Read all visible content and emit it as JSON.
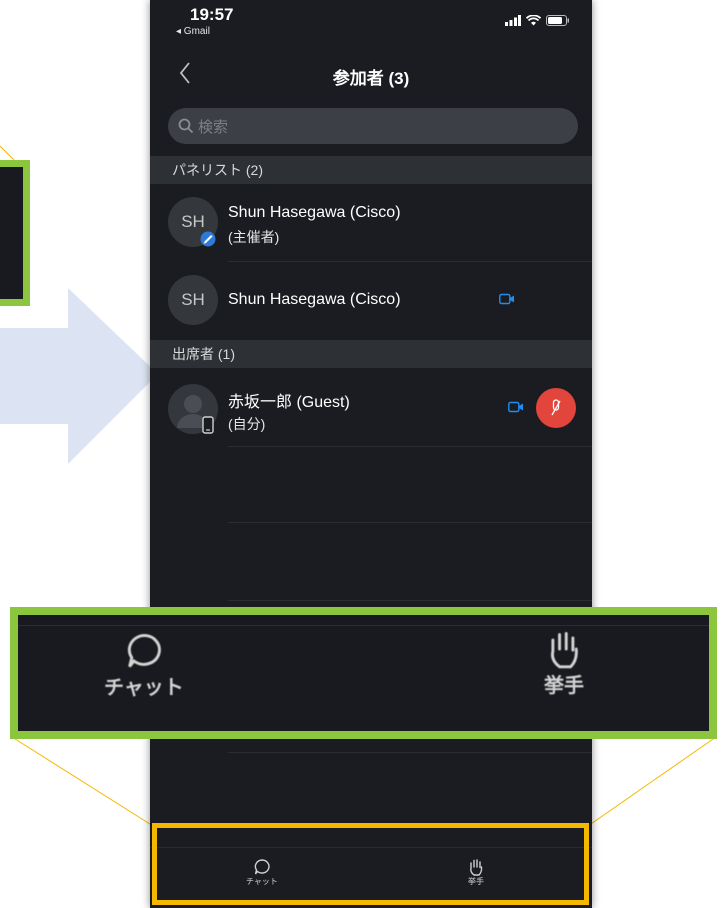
{
  "status": {
    "time": "19:57",
    "back_app": "◂ Gmail"
  },
  "nav": {
    "title": "参加者 (3)"
  },
  "search": {
    "placeholder": "検索"
  },
  "sections": {
    "panelists": "パネリスト (2)",
    "attendees": "出席者 (1)"
  },
  "participants": [
    {
      "initials": "SH",
      "name": "Shun Hasegawa (Cisco)",
      "role": "(主催者)"
    },
    {
      "initials": "SH",
      "name": "Shun Hasegawa (Cisco)",
      "role": ""
    },
    {
      "initials": "",
      "name": "赤坂一郎 (Guest)",
      "role": "(自分)"
    }
  ],
  "bottom_bar": {
    "chat": "チャット",
    "raise_hand": "挙手"
  },
  "zoom": {
    "chat": "チャット",
    "raise_hand": "挙手"
  },
  "colors": {
    "phone_bg": "#1a1c21",
    "section_bg": "#2d3035",
    "search_bg": "#3c3f45",
    "mute_red": "#e2453c",
    "video_blue": "#1e8ef0",
    "highlight_green": "#8cc63f",
    "highlight_yellow": "#f5b800",
    "arrow": "#dce3f2"
  },
  "icons": [
    "back-chevron-icon",
    "search-icon",
    "video-icon",
    "muted-mic-icon",
    "chat-icon",
    "raise-hand-icon",
    "signal-icon",
    "wifi-icon",
    "battery-icon",
    "phone-device-icon",
    "host-badge-icon"
  ]
}
